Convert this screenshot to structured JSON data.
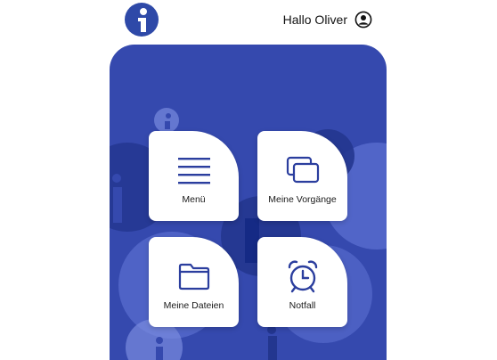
{
  "header": {
    "logo_icon": "info-logo-icon",
    "greeting": "Hallo Oliver",
    "profile_icon": "user-circle-icon"
  },
  "theme": {
    "panel_color": "#3549AE",
    "accent_color": "#2B3E9E"
  },
  "tiles": [
    {
      "label": "Menü",
      "icon": "menu-icon"
    },
    {
      "label": "Meine Vorgänge",
      "icon": "copy-icon"
    },
    {
      "label": "Meine Dateien",
      "icon": "folder-icon"
    },
    {
      "label": "Notfall",
      "icon": "alarm-clock-icon"
    }
  ]
}
